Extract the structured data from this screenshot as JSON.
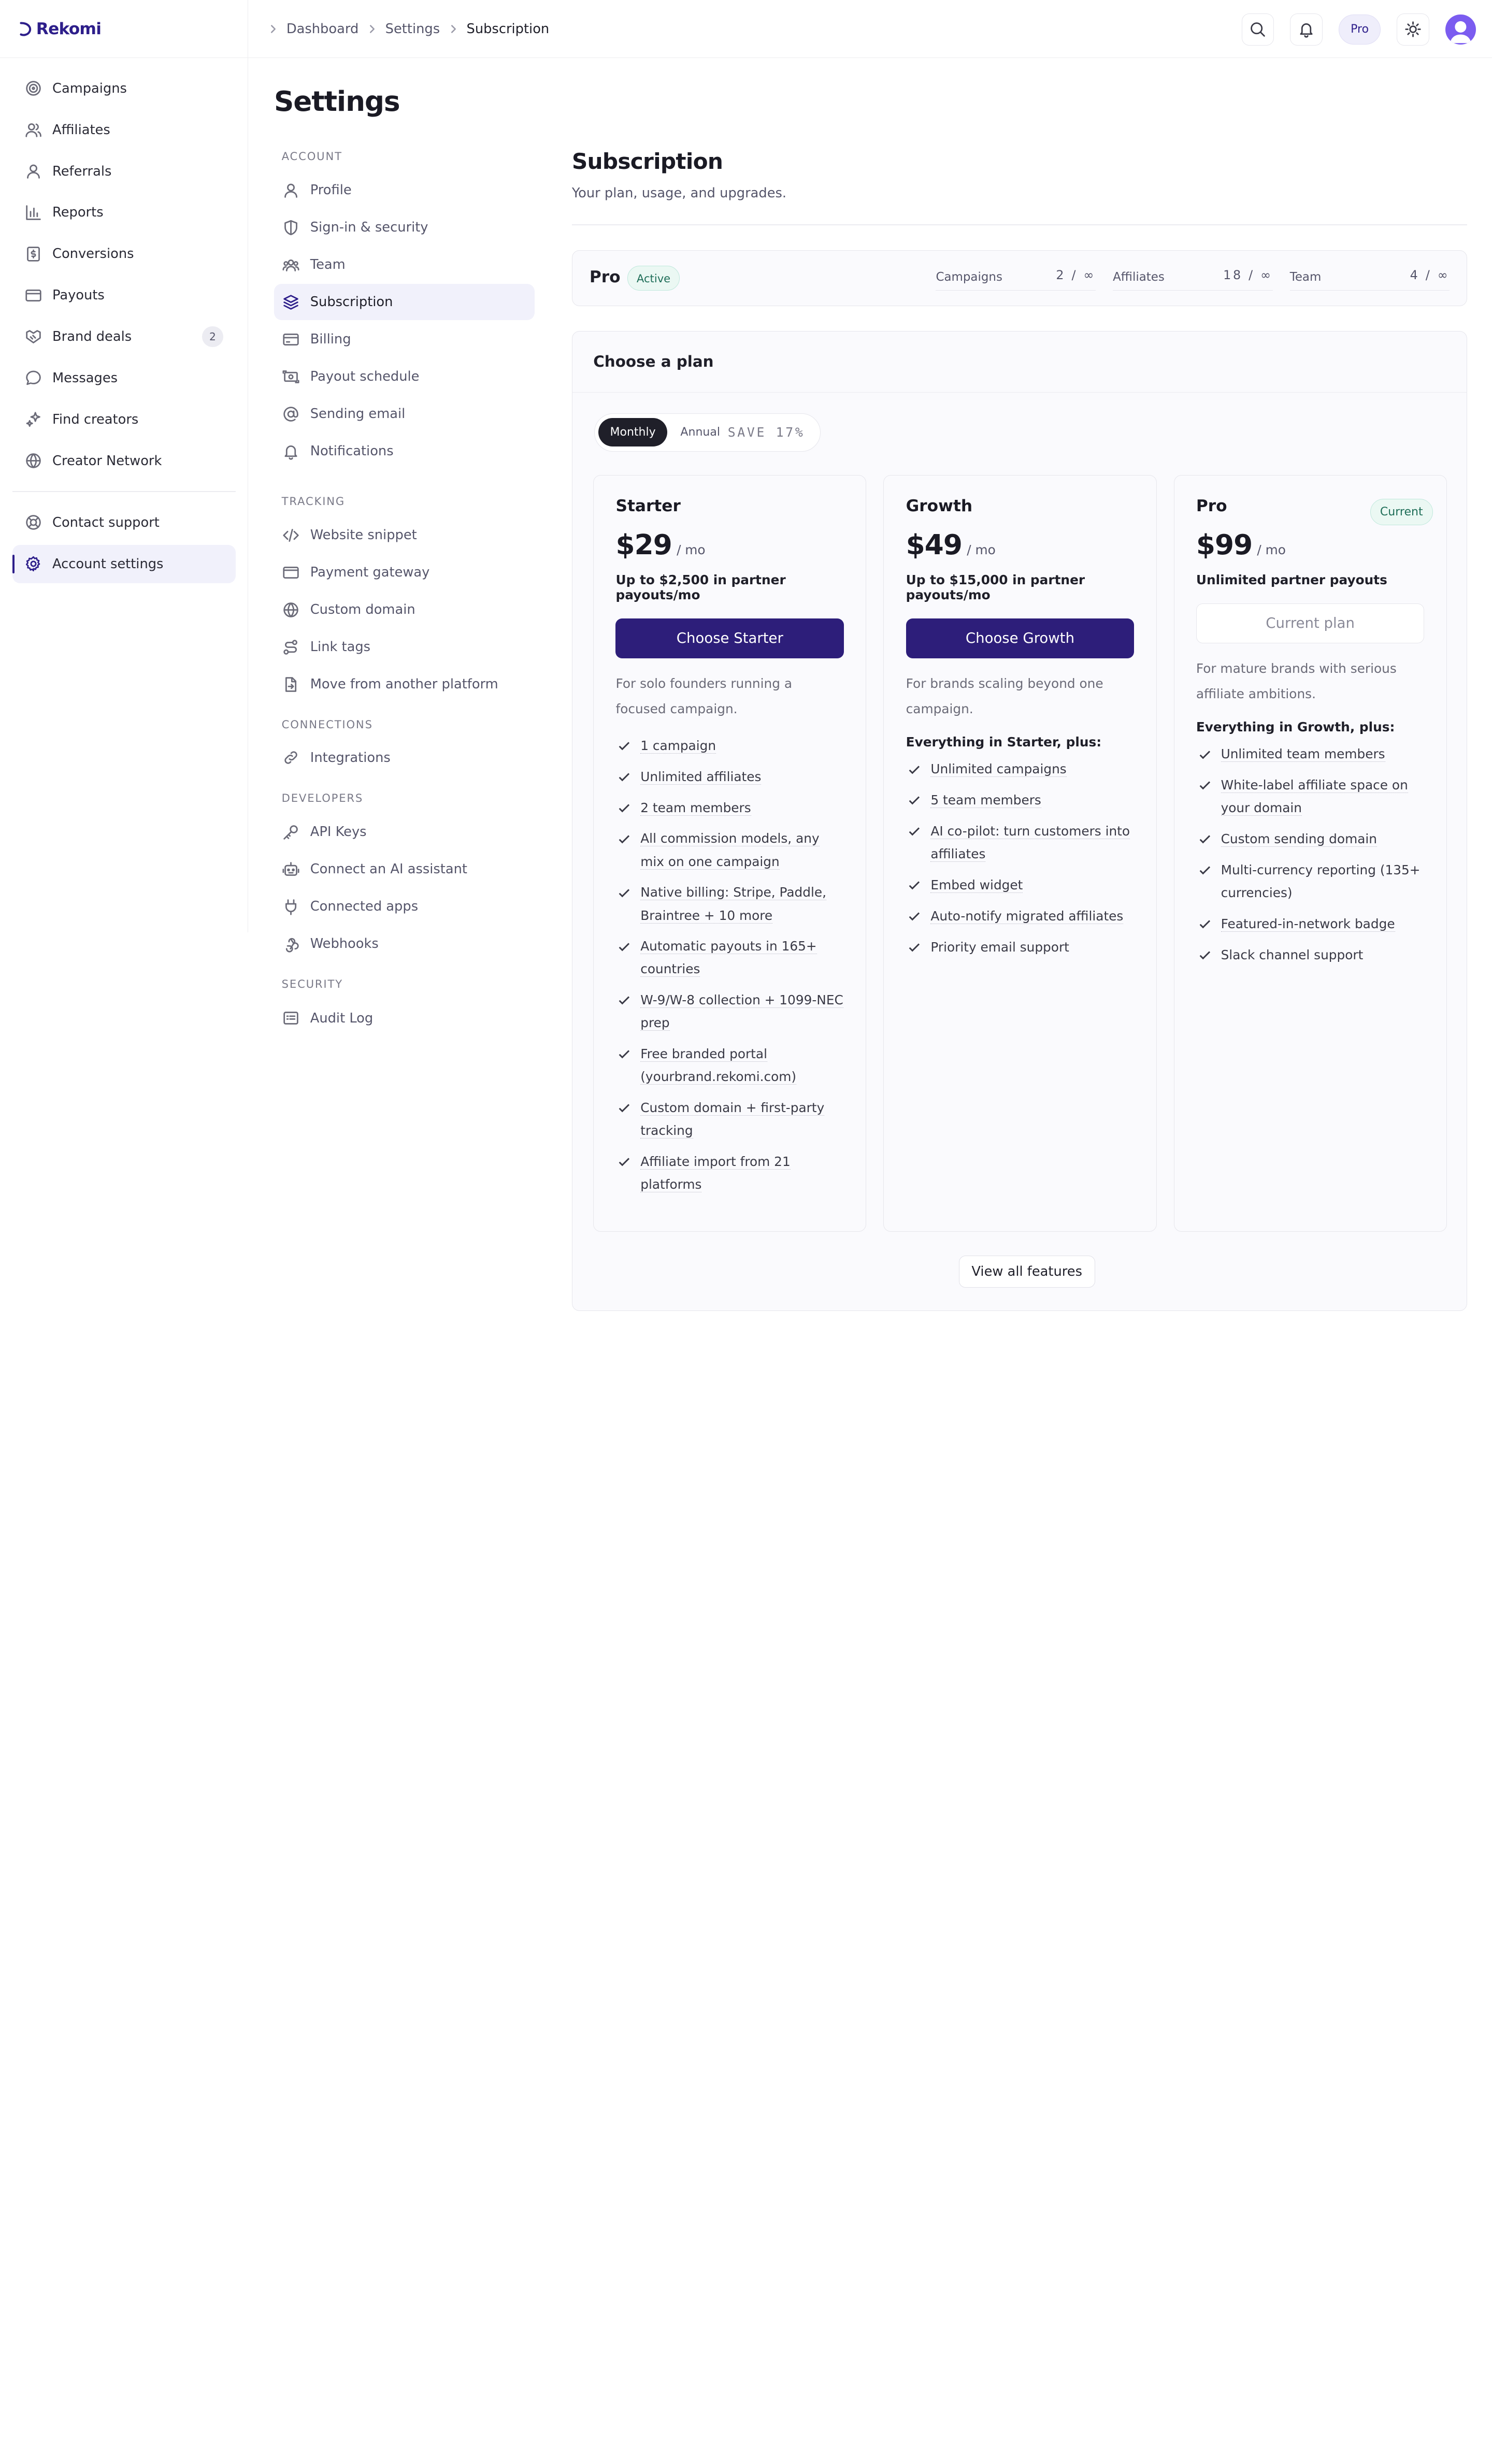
{
  "brand": {
    "name": "Rekomi"
  },
  "sidebar": {
    "items": [
      {
        "label": "Campaigns",
        "icon": "target-icon"
      },
      {
        "label": "Affiliates",
        "icon": "users-icon"
      },
      {
        "label": "Referrals",
        "icon": "user-icon"
      },
      {
        "label": "Reports",
        "icon": "bar-chart-icon"
      },
      {
        "label": "Conversions",
        "icon": "receipt-icon"
      },
      {
        "label": "Payouts",
        "icon": "card-icon"
      },
      {
        "label": "Brand deals",
        "icon": "handshake-icon",
        "badge": "2"
      },
      {
        "label": "Messages",
        "icon": "message-icon"
      },
      {
        "label": "Find creators",
        "icon": "sparkle-icon"
      },
      {
        "label": "Creator Network",
        "icon": "globe-icon"
      }
    ],
    "bottom": [
      {
        "label": "Contact support",
        "icon": "lifebuoy-icon"
      },
      {
        "label": "Account settings",
        "icon": "gear-icon",
        "active": true
      }
    ]
  },
  "header": {
    "breadcrumbs": [
      "Dashboard",
      "Settings",
      "Subscription"
    ],
    "plan_pill": "Pro"
  },
  "page": {
    "title": "Settings"
  },
  "settings_nav": {
    "sections": [
      {
        "title": "ACCOUNT",
        "items": [
          "Profile",
          "Sign-in & security",
          "Team",
          "Subscription",
          "Billing",
          "Payout schedule",
          "Sending email",
          "Notifications"
        ]
      },
      {
        "title": "TRACKING",
        "items": [
          "Website snippet",
          "Payment gateway",
          "Custom domain",
          "Link tags",
          "Move from another platform"
        ]
      },
      {
        "title": "CONNECTIONS",
        "items": [
          "Integrations"
        ]
      },
      {
        "title": "DEVELOPERS",
        "items": [
          "API Keys",
          "Connect an AI assistant",
          "Connected apps",
          "Webhooks"
        ]
      },
      {
        "title": "SECURITY",
        "items": [
          "Audit Log"
        ]
      }
    ],
    "active": "Subscription"
  },
  "subscription": {
    "title": "Subscription",
    "description": "Your plan, usage, and upgrades.",
    "current": {
      "plan": "Pro",
      "status": "Active",
      "usage": [
        {
          "label": "Campaigns",
          "value": "2 / ∞"
        },
        {
          "label": "Affiliates",
          "value": "18 / ∞"
        },
        {
          "label": "Team",
          "value": "4 / ∞"
        }
      ]
    },
    "choose_title": "Choose a plan",
    "billing_toggle": {
      "monthly": "Monthly",
      "annual": "Annual",
      "save": "SAVE 17%"
    },
    "plans": [
      {
        "name": "Starter",
        "price": "$29",
        "period": "/ mo",
        "limit": "Up to $2,500 in partner payouts/mo",
        "button": "Choose Starter",
        "description": "For solo founders running a focused campaign.",
        "includes": "",
        "features": [
          "1 campaign",
          "Unlimited affiliates",
          "2 team members",
          "All commission models, any mix on one campaign",
          "Native billing: Stripe, Paddle, Braintree + 10 more",
          "Automatic payouts in 165+ countries",
          "W-9/W-8 collection + 1099-NEC prep",
          "Free branded portal (yourbrand.rekomi.com)",
          "Custom domain + first-party tracking",
          "Affiliate import from 21 platforms"
        ]
      },
      {
        "name": "Growth",
        "price": "$49",
        "period": "/ mo",
        "limit": "Up to $15,000 in partner payouts/mo",
        "button": "Choose Growth",
        "description": "For brands scaling beyond one campaign.",
        "includes": "Everything in Starter, plus:",
        "features": [
          "Unlimited campaigns",
          "5 team members",
          "AI co-pilot: turn customers into affiliates",
          "Embed widget",
          "Auto-notify migrated affiliates",
          "Priority email support"
        ]
      },
      {
        "name": "Pro",
        "badge": "Current",
        "price": "$99",
        "period": "/ mo",
        "limit": "Unlimited partner payouts",
        "button": "Current plan",
        "description": "For mature brands with serious affiliate ambitions.",
        "includes": "Everything in Growth, plus:",
        "features": [
          "Unlimited team members",
          "White-label affiliate space on your domain",
          "Custom sending domain",
          "Multi-currency reporting (135+ currencies)",
          "Featured-in-network badge",
          "Slack channel support"
        ]
      }
    ],
    "view_all": "View all features"
  },
  "colors": {
    "brand": "#2d1e8a",
    "primary_button": "#2d1e7a",
    "success": "#1f6e58",
    "active_bg": "#f1f1fb"
  }
}
